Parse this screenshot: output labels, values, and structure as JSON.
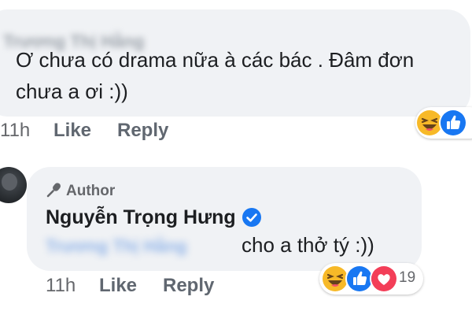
{
  "comments": [
    {
      "author_name": "Trương Thị Hằng",
      "text": "Ơ chưa có drama nữa à các bác . Đâm đơn chưa a ơi :))",
      "time": "11h",
      "like_label": "Like",
      "reply_label": "Reply",
      "reactions": [
        "haha-icon",
        "like-icon"
      ]
    },
    {
      "author_badge": "Author",
      "author_name": "Nguyễn Trọng Hưng",
      "verified": true,
      "mention": "Trương Thị Hằng",
      "text": "cho a thở tý :))",
      "time": "11h",
      "like_label": "Like",
      "reply_label": "Reply",
      "reactions": [
        "haha-icon",
        "like-icon",
        "love-icon"
      ],
      "reaction_count": "19"
    }
  ],
  "colors": {
    "bubble": "#f0f2f5",
    "meta_text": "#65676b",
    "like_blue": "#1877f2",
    "love_red": "#f33e58",
    "haha_yellow": "#f7b928"
  }
}
